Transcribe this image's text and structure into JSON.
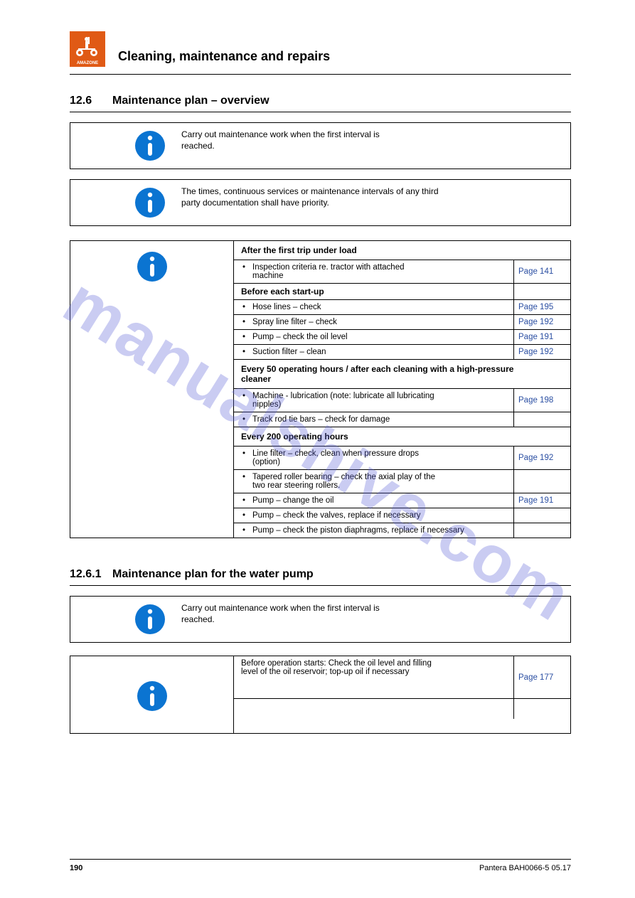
{
  "header": {
    "logo_label": "AMAZONE",
    "chapter_title": "Cleaning, maintenance and repairs"
  },
  "section_main": {
    "number": "12.6",
    "title": "Maintenance plan – overview"
  },
  "note_intervals": {
    "text": "Carry out maintenance work when the first interval is\nreached."
  },
  "note_priority": {
    "text": "The times, continuous services or maintenance intervals of any third\nparty documentation shall have priority."
  },
  "plan": {
    "groups": [
      {
        "heading": "After the first trip under load",
        "rows": [
          {
            "desc": "Inspection criteria re. tractor with attached\nmachine",
            "bullet": true,
            "link": "Page 141"
          }
        ]
      },
      {
        "heading": "Before each start-up",
        "rows": [
          {
            "desc": "Hose lines – check",
            "link": "Page 195"
          },
          {
            "desc": "Spray line filter – check",
            "link": "Page 192"
          },
          {
            "desc": "Pump – check the oil level",
            "link": "Page 191"
          },
          {
            "desc": "Suction filter – clean",
            "link": "Page 192"
          }
        ]
      },
      {
        "heading": "Every 50 operating hours / after each cleaning with a high-pressure\ncleaner",
        "rows": [
          {
            "desc": "Machine - lubrication (note: lubricate all lubricating\nnipples)",
            "link": "Page 198"
          },
          {
            "desc": "Track rod tie bars – check for damage",
            "link": ""
          }
        ]
      },
      {
        "heading": "Every 200 operating hours",
        "rows": [
          {
            "desc": "Line filter – check, clean when pressure drops\n(option)",
            "link": "Page 192"
          },
          {
            "desc": "Tapered roller bearing – check the axial play of the\ntwo rear steering rollers.",
            "link": ""
          },
          {
            "desc": "Pump – change the oil",
            "link": "Page 191"
          },
          {
            "desc": "Pump – check the valves, replace if necessary",
            "link": ""
          },
          {
            "desc": "Pump – check the piston diaphragms, replace if necessary",
            "link": ""
          }
        ]
      }
    ]
  },
  "section_pump": {
    "number": "12.6.1",
    "title": "Maintenance plan for the water pump"
  },
  "note_pump": {
    "text": "Carry out maintenance work when the first interval is\nreached."
  },
  "pump_plan": {
    "rows": [
      {
        "desc": "Before operation starts: Check the oil level and filling\nlevel of the oil reservoir; top-up oil if necessary",
        "link": "Page 177"
      },
      {
        "desc": "",
        "link": ""
      }
    ]
  },
  "footer": {
    "page": "190",
    "doc": "Pantera  BAH0066-5  05.17"
  },
  "watermark": "manualshive.com"
}
